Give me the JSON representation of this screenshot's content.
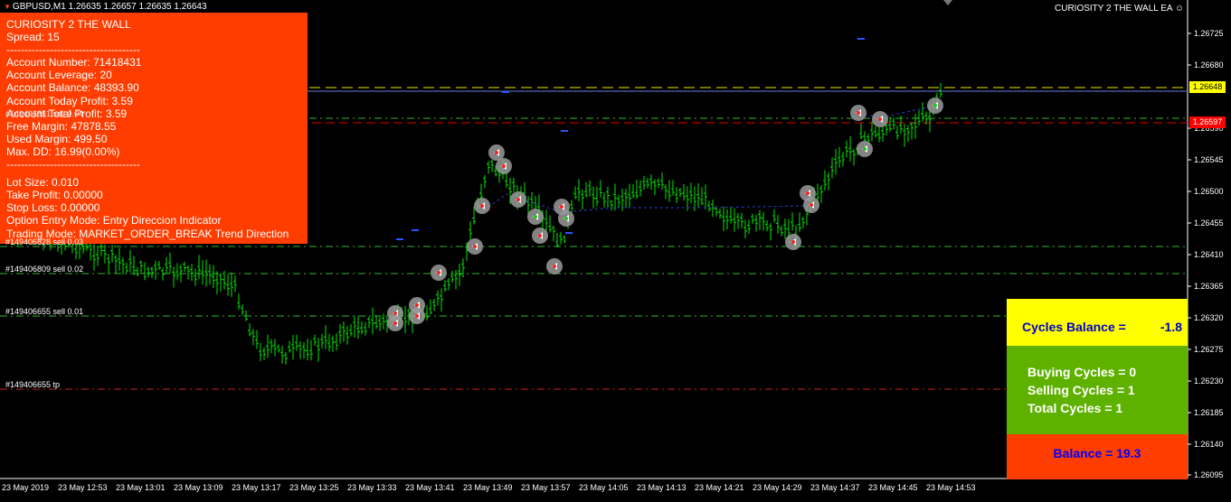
{
  "header": {
    "symbol_line": "GBPUSD,M1  1.26635 1.26657 1.26635 1.26643",
    "ea_title": "CURIOSITY 2  THE WALL EA ☺"
  },
  "panel": {
    "lines": [
      "CURIOSITY 2 THE WALL",
      "Spread: 15",
      "-------------------------------------",
      "Account Number: 71418431",
      "Account Leverage: 20",
      "Account Balance: 48393.90",
      "Account Today Profit: 3.59",
      "Account Total Profit: 3.59",
      "Free Margin: 47878.55",
      "Used Margin: 499.50",
      "Max. DD: 16.99(0.00%)",
      "-------------------------------------",
      "Lot Size: 0.010",
      "Take Profit: 0.00000",
      "Stop Loss: 0.00000",
      "Option Entry Mode:  Entry Direccion Indicator",
      "Trading Mode: MARKET_ORDER_BREAK  Trend Direction"
    ]
  },
  "order_labels": [
    "#149406851 sell 0.04",
    "#149406828 sell 0.03",
    "#149406809 sell 0.02",
    "#149406655 sell 0.01",
    "#149406655 tp"
  ],
  "price_tags": {
    "current": "1.26648",
    "red": "1.26597"
  },
  "price_axis": [
    "1.26725",
    "1.26680",
    "1.26590",
    "1.26545",
    "1.26500",
    "1.26455",
    "1.26410",
    "1.26365",
    "1.26320",
    "1.26275",
    "1.26230",
    "1.26185",
    "1.26140",
    "1.26095"
  ],
  "time_axis": [
    "23 May 2019",
    "23 May 12:53",
    "23 May 13:01",
    "23 May 13:09",
    "23 May 13:17",
    "23 May 13:25",
    "23 May 13:33",
    "23 May 13:41",
    "23 May 13:49",
    "23 May 13:57",
    "23 May 14:05",
    "23 May 14:13",
    "23 May 14:21",
    "23 May 14:29",
    "23 May 14:37",
    "23 May 14:45",
    "23 May 14:53"
  ],
  "cycles": {
    "balance_label": "Cycles Balance =",
    "balance_value": "-1.8",
    "buying": "Buying Cycles = 0",
    "selling": "Selling Cycles = 1",
    "total": "Total Cycles    = 1",
    "balance_footer": "Balance = 19.3"
  },
  "colors": {
    "background": "#000000",
    "bars": "#00ff00",
    "panel": "#ff3d00",
    "current_price": "#ffff00",
    "sl_line": "#ff0000",
    "order_line": "#00cc00"
  }
}
